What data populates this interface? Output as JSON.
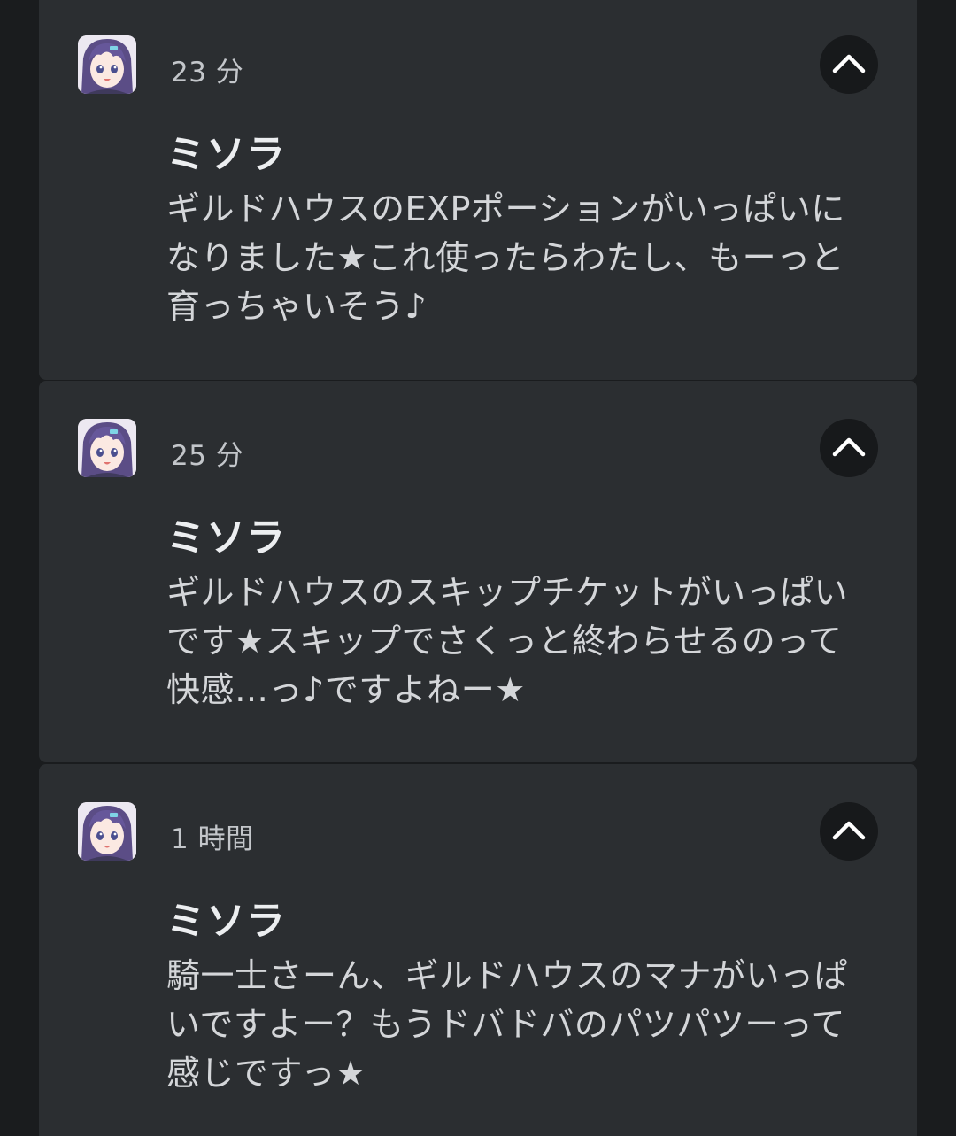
{
  "notifications": [
    {
      "time": "23 分",
      "title": "ミソラ",
      "message": "ギルドハウスのEXPポーションがいっぱいになりました★これ使ったらわたし、もーっと育っちゃいそう♪"
    },
    {
      "time": "25 分",
      "title": "ミソラ",
      "message": "ギルドハウスのスキップチケットがいっぱいです★スキップでさくっと終わらせるのって快感…っ♪ですよねー★"
    },
    {
      "time": "1 時間",
      "title": "ミソラ",
      "message": "騎一士さーん、ギルドハウスのマナがいっぱいですよー？もうドバドバのパツパツーって感じですっ★"
    }
  ],
  "icons": {
    "avatar": "app-avatar-icon",
    "expand": "chevron-up-icon"
  },
  "colors": {
    "background": "#1a1c1e",
    "card": "#2b2e31",
    "button": "#17191b",
    "title": "#eceef0",
    "text": "#d4d6d9",
    "time": "#c3c6ca"
  }
}
